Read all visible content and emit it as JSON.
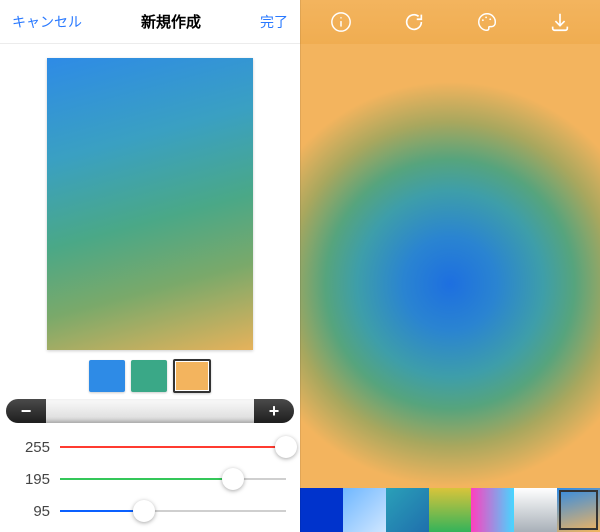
{
  "left": {
    "nav": {
      "cancel": "キャンセル",
      "title": "新規作成",
      "done": "完了"
    },
    "swatches": [
      {
        "color": "#2e8be6",
        "selected": false
      },
      {
        "color": "#3aa887",
        "selected": false
      },
      {
        "color": "#f3b45e",
        "selected": true
      }
    ],
    "tray": {
      "minus": "−",
      "plus": "+"
    },
    "sliders": {
      "r": {
        "value": 255,
        "max": 255,
        "color": "#ff3b30"
      },
      "g": {
        "value": 195,
        "max": 255,
        "color": "#34c759"
      },
      "b": {
        "value": 95,
        "max": 255,
        "color": "#0a60ff"
      }
    }
  },
  "right": {
    "toolbar": {
      "info": "info-icon",
      "refresh": "refresh-icon",
      "palette": "palette-icon",
      "download": "download-icon"
    },
    "presets": [
      {
        "bg": "linear-gradient(135deg,#0033cc,#0033cc)",
        "selected": false
      },
      {
        "bg": "linear-gradient(135deg,#6fb7ff,#cfe6ff)",
        "selected": false
      },
      {
        "bg": "linear-gradient(135deg,#2aa0b8,#1f6fad)",
        "selected": false
      },
      {
        "bg": "linear-gradient(to bottom,#d9c43a,#34b35a)",
        "selected": false
      },
      {
        "bg": "linear-gradient(to right,#ff3fbf,#47d6ff)",
        "selected": false
      },
      {
        "bg": "linear-gradient(to bottom,#ffffff,#a8b0b8)",
        "selected": false
      },
      {
        "bg": "linear-gradient(165deg,#2e8be6,#f3b45e)",
        "selected": true
      }
    ]
  }
}
